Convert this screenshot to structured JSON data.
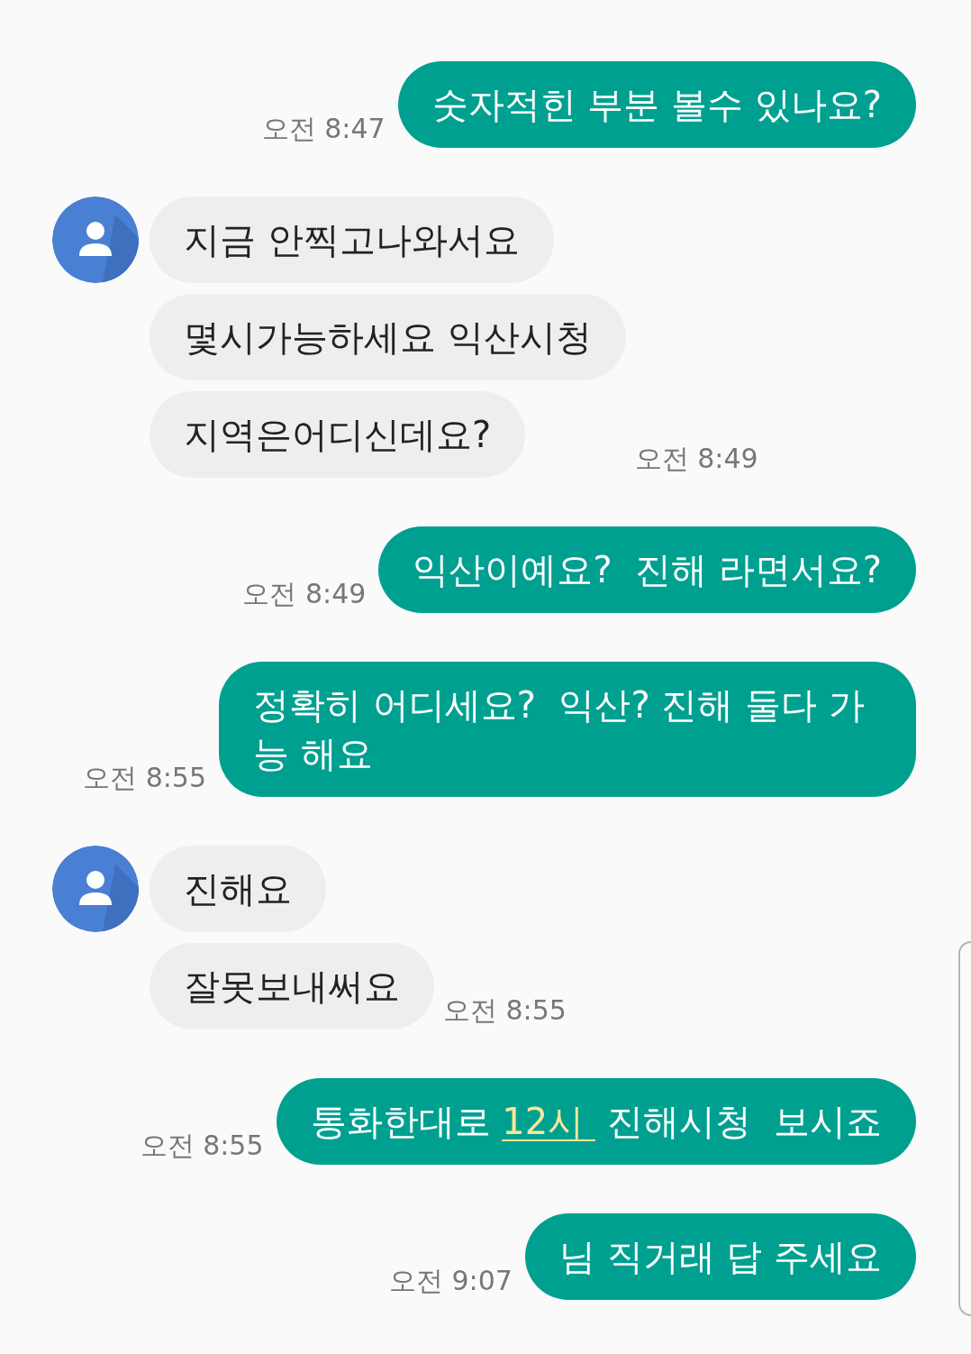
{
  "messages": [
    {
      "kind": "sent",
      "time": "오전 8:47",
      "bubbles": [
        {
          "segments": [
            {
              "kind": "text",
              "text": "숫자적힌 부분 볼수 있나요?"
            }
          ]
        }
      ]
    },
    {
      "kind": "received",
      "time": "오전 8:49",
      "bubbles": [
        {
          "segments": [
            {
              "kind": "text",
              "text": "지금 안찍고나와서요"
            }
          ]
        },
        {
          "segments": [
            {
              "kind": "text",
              "text": "몇시가능하세요 익산시청"
            }
          ]
        },
        {
          "segments": [
            {
              "kind": "text",
              "text": "지역은어디신데요?"
            }
          ]
        }
      ]
    },
    {
      "kind": "sent",
      "time": "오전 8:49",
      "bubbles": [
        {
          "segments": [
            {
              "kind": "text",
              "text": "익산이예요?  진해 라면서요?"
            }
          ]
        }
      ]
    },
    {
      "kind": "sent",
      "time": "오전 8:55",
      "bubbles": [
        {
          "segments": [
            {
              "kind": "text",
              "text": "정확히 어디세요?  익산? 진해 둘다 가능 해요"
            }
          ]
        }
      ]
    },
    {
      "kind": "received",
      "time": "오전 8:55",
      "bubbles": [
        {
          "segments": [
            {
              "kind": "text",
              "text": "진해요"
            }
          ]
        },
        {
          "segments": [
            {
              "kind": "text",
              "text": "잘못보내써요"
            }
          ]
        }
      ]
    },
    {
      "kind": "sent",
      "time": "오전 8:55",
      "bubbles": [
        {
          "segments": [
            {
              "kind": "text",
              "text": "통화한대로 "
            },
            {
              "kind": "link",
              "text": "12시 "
            },
            {
              "kind": "text",
              "text": " 진해시청  보시죠"
            }
          ]
        }
      ]
    },
    {
      "kind": "sent",
      "time": "오전 9:07",
      "bubbles": [
        {
          "segments": [
            {
              "kind": "text",
              "text": "님 직거래 답 주세요"
            }
          ]
        }
      ]
    }
  ]
}
